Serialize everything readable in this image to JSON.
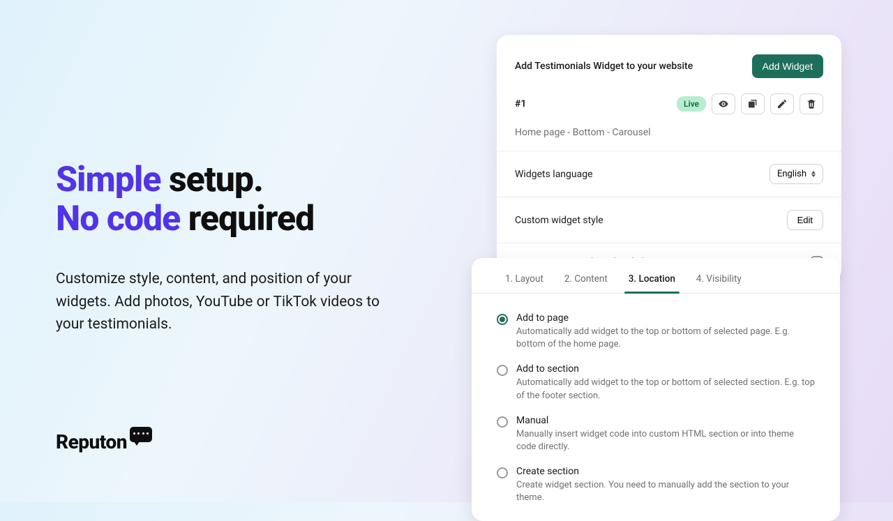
{
  "hero": {
    "line1_accent": "Simple",
    "line1_rest": " setup.",
    "line2_accent": "No code",
    "line2_rest": " required",
    "subtitle": "Customize style, content, and position of your widgets. Add photos, YouTube or TikTok videos to your testimonials."
  },
  "brand": "Reputon",
  "topcard": {
    "title": "Add Testimonials Widget to your website",
    "add_button": "Add Widget",
    "widget": {
      "id": "#1",
      "status": "Live",
      "description": "Home page - Bottom - Carousel"
    },
    "language_label": "Widgets language",
    "language_value": "English",
    "style_label": "Custom widget style",
    "style_button": "Edit",
    "branding_label": "Remove Reputon branding link"
  },
  "bottomcard": {
    "tabs": [
      "1. Layout",
      "2. Content",
      "3. Location",
      "4. Visibility"
    ],
    "active_tab": 2,
    "options": [
      {
        "title": "Add to page",
        "desc": "Automatically add widget to the top or bottom of selected page. E.g. bottom of the home page.",
        "selected": true
      },
      {
        "title": "Add to section",
        "desc": "Automatically add widget to the top or bottom of selected section. E.g. top of the footer section.",
        "selected": false
      },
      {
        "title": "Manual",
        "desc": "Manually insert widget code into custom HTML section or into theme code directly.",
        "selected": false
      },
      {
        "title": "Create section",
        "desc": "Create widget section. You need to manually add the section to your theme.",
        "selected": false
      }
    ]
  }
}
